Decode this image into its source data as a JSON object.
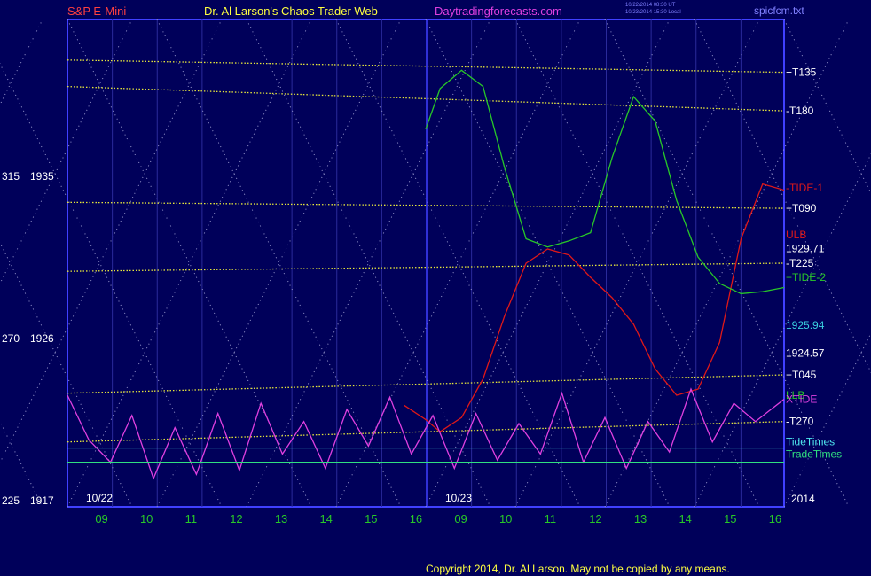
{
  "header": {
    "symbol": "S&P E-Mini",
    "title": "Dr. Al Larson's Chaos Trader Web",
    "site": "Daytradingforecasts.com",
    "stamp1": "10/22/2014 08:30 UT",
    "stamp2": "10/23/2014 15:30 Local",
    "file": "spicfcm.txt"
  },
  "footer": {
    "copyright": "Copyright 2014, Dr. Al Larson. May not be copied by any means."
  },
  "colors": {
    "background": "#00005a",
    "frame": "#4040ff",
    "grid_dots": "#9b9bd0",
    "yellow": "#e8e83a",
    "red": "#e01818",
    "green": "#28c828",
    "cyan": "#3ad0e0",
    "white": "#ffffff",
    "magenta": "#e040e0",
    "tide_times": "#4fe8f0",
    "trade_times": "#30e080"
  },
  "chart_data": {
    "type": "line",
    "title": "S&P E-Mini",
    "y_price_labels": [
      {
        "angle": "315",
        "price": "1935"
      },
      {
        "angle": "270",
        "price": "1926"
      },
      {
        "angle": "225",
        "price": "1917"
      }
    ],
    "ylim": [
      1917,
      1941
    ],
    "x_day1_hours": [
      "09",
      "10",
      "11",
      "12",
      "13",
      "14",
      "15",
      "16"
    ],
    "x_day2_hours": [
      "09",
      "10",
      "11",
      "12",
      "13",
      "14",
      "15",
      "16"
    ],
    "date_labels": [
      "10/22",
      "10/23"
    ],
    "year_label": "2014",
    "right_labels": [
      {
        "text": "+T135",
        "color": "#ffffff",
        "value": 1938.4
      },
      {
        "text": "-T180",
        "color": "#ffffff",
        "value": 1936.5
      },
      {
        "text": "-TIDE-1",
        "color": "#e01818",
        "value": 1932.7
      },
      {
        "text": "+T090",
        "color": "#ffffff",
        "value": 1931.7
      },
      {
        "text": "ULB",
        "color": "#e01818",
        "value": 1930.4
      },
      {
        "text": "1929.71",
        "color": "#ffffff",
        "value": 1929.71
      },
      {
        "text": "-T225",
        "color": "#ffffff",
        "value": 1929.0
      },
      {
        "text": "+TIDE-2",
        "color": "#28c828",
        "value": 1928.3
      },
      {
        "text": "1925.94",
        "color": "#3ad0e0",
        "value": 1925.94
      },
      {
        "text": "1924.57",
        "color": "#ffffff",
        "value": 1924.57
      },
      {
        "text": "+T045",
        "color": "#ffffff",
        "value": 1923.5
      },
      {
        "text": "LLB",
        "color": "#28c828",
        "value": 1922.5
      },
      {
        "text": "XTIDE",
        "color": "#e040e0",
        "value": 1922.3
      },
      {
        "text": "-T270",
        "color": "#ffffff",
        "value": 1921.2
      },
      {
        "text": "TideTimes",
        "color": "#4fe8f0",
        "value": 1920.2
      },
      {
        "text": "TradeTimes",
        "color": "#30e080",
        "value": 1919.6
      }
    ],
    "series": [
      {
        "name": "+T135",
        "color": "#e8e83a",
        "style": "dotted",
        "x": [
          0,
          1
        ],
        "values": [
          1939.0,
          1938.4
        ]
      },
      {
        "name": "-T180",
        "color": "#e8e83a",
        "style": "dotted",
        "x": [
          0,
          1
        ],
        "values": [
          1937.7,
          1936.5
        ]
      },
      {
        "name": "+T090",
        "color": "#e8e83a",
        "style": "dotted",
        "x": [
          0,
          1
        ],
        "values": [
          1932.0,
          1931.7
        ]
      },
      {
        "name": "-T225",
        "color": "#e8e83a",
        "style": "dotted",
        "x": [
          0,
          1
        ],
        "values": [
          1928.6,
          1929.0
        ]
      },
      {
        "name": "+T045",
        "color": "#e8e83a",
        "style": "dotted",
        "x": [
          0,
          1
        ],
        "values": [
          1922.6,
          1923.5
        ]
      },
      {
        "name": "-T270",
        "color": "#e8e83a",
        "style": "dotted",
        "x": [
          0,
          1
        ],
        "values": [
          1920.2,
          1921.2
        ]
      },
      {
        "name": "-TIDE-1",
        "color": "#e01818",
        "style": "solid",
        "x": [
          0.47,
          0.5,
          0.52,
          0.55,
          0.58,
          0.61,
          0.64,
          0.67,
          0.7,
          0.73,
          0.76,
          0.79,
          0.82,
          0.85,
          0.88,
          0.91,
          0.94,
          0.97,
          1.0
        ],
        "values": [
          1922.0,
          1921.3,
          1920.7,
          1921.4,
          1923.3,
          1926.4,
          1929.0,
          1929.7,
          1929.4,
          1928.3,
          1927.3,
          1926.0,
          1923.8,
          1922.5,
          1922.8,
          1925.1,
          1930.2,
          1932.9,
          1932.6
        ]
      },
      {
        "name": "+TIDE-2",
        "color": "#28c828",
        "style": "solid",
        "x": [
          0.5,
          0.52,
          0.55,
          0.58,
          0.61,
          0.64,
          0.67,
          0.7,
          0.73,
          0.76,
          0.79,
          0.82,
          0.85,
          0.88,
          0.91,
          0.94,
          0.97,
          1.0
        ],
        "values": [
          1935.6,
          1937.6,
          1938.5,
          1937.7,
          1933.7,
          1930.2,
          1929.8,
          1930.1,
          1930.5,
          1934.2,
          1937.2,
          1936.0,
          1932.1,
          1929.3,
          1928.0,
          1927.5,
          1927.6,
          1927.8
        ]
      },
      {
        "name": "XTIDE",
        "color": "#e040e0",
        "style": "solid",
        "x": [
          0,
          0.03,
          0.06,
          0.09,
          0.12,
          0.15,
          0.18,
          0.21,
          0.24,
          0.27,
          0.3,
          0.33,
          0.36,
          0.39,
          0.42,
          0.45,
          0.48,
          0.51,
          0.54,
          0.57,
          0.6,
          0.63,
          0.66,
          0.69,
          0.72,
          0.75,
          0.78,
          0.81,
          0.84,
          0.87,
          0.9,
          0.93,
          0.96,
          1.0
        ],
        "values": [
          1922.5,
          1920.3,
          1919.2,
          1921.5,
          1918.4,
          1920.9,
          1918.6,
          1921.6,
          1918.8,
          1922.1,
          1919.6,
          1921.2,
          1918.9,
          1921.8,
          1920.0,
          1922.4,
          1919.6,
          1921.5,
          1918.9,
          1921.6,
          1919.3,
          1921.1,
          1919.6,
          1922.6,
          1919.2,
          1921.4,
          1918.9,
          1921.2,
          1919.7,
          1922.8,
          1920.2,
          1922.1,
          1921.2,
          1922.3
        ]
      }
    ]
  }
}
